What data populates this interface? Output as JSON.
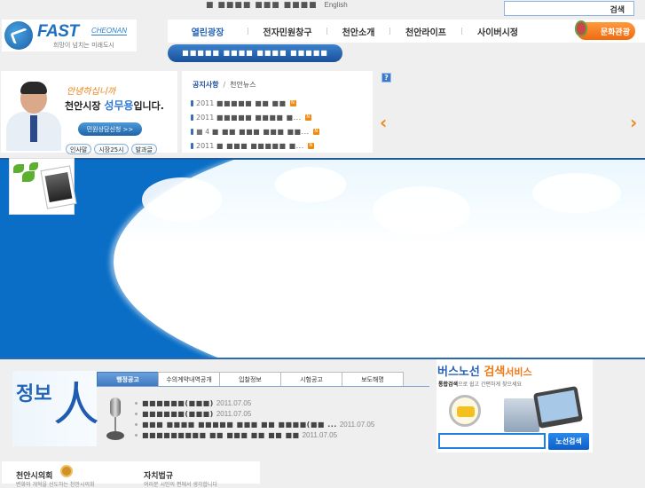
{
  "utility": {
    "links_text": "■ ■■■■ ■■■ ■■■■",
    "english": "English",
    "search_button": "검색",
    "search_placeholder": ""
  },
  "logo": {
    "brand": "FAST",
    "sub": "CHEONAN",
    "slogan": "희망이 넘치는 미래도시"
  },
  "nav": {
    "items": [
      "열린광장",
      "전자민원창구",
      "천안소개",
      "천안라이프",
      "사이버시정"
    ],
    "active_index": 0,
    "culture_button": "문화관광",
    "submenu_text": "■■■■■ ■■■■ ■■■■ ■■■■■"
  },
  "mayor": {
    "greeting": "안녕하십니까",
    "intro_prefix": "천안시장 ",
    "name": "성무용",
    "intro_suffix": "입니다.",
    "consult_button": "민원상담신청  >>",
    "pills": [
      "인사말",
      "시장25시",
      "발과글"
    ]
  },
  "notice": {
    "tab_active": "공지사항",
    "tab_separator": "/",
    "tab_other": "천안뉴스",
    "items": [
      {
        "year": "2011",
        "title": "■■■■■ ■■ ■■",
        "new": "N"
      },
      {
        "year": "2011",
        "title": "■■■■■ ■■■■ ■...",
        "new": "N"
      },
      {
        "year": "■ 4",
        "title": "■ ■■ ■■■ ■■■ ■■...",
        "new": "N"
      },
      {
        "year": "2011",
        "title": "■ ■■■ ■■■■■ ■...",
        "new": "N"
      }
    ]
  },
  "slider": {
    "help_label": "?",
    "prev_label": "‹",
    "next_label": "›"
  },
  "info": {
    "logo_text": "정보",
    "logo_char": "人",
    "tabs": [
      "행정공고",
      "수의계약내역공개",
      "입찰정보",
      "시험공고",
      "보도해명"
    ],
    "active_tab": 0,
    "items": [
      {
        "title": "■■■■■■(■■■)",
        "date": "2011.07.05"
      },
      {
        "title": "■■■■■■(■■■)",
        "date": "2011.07.05"
      },
      {
        "title": "■■■ ■■■■ ■■■■■ ■■■ ■■ ■■■■(■■ ...",
        "date": "2011.07.05"
      },
      {
        "title": "■■■■■■■■■ ■■ ■■■ ■■ ■■ ■■",
        "date": "2011.07.05"
      }
    ]
  },
  "bus": {
    "title_blue": "버스노선 ",
    "title_orange": "검색",
    "title_small": "서비스",
    "sub_bold": "통합검색",
    "sub_rest": "으로 쉽고 간편하게 찾으세요",
    "input_value": "",
    "search_button": "노선검색"
  },
  "bottom": {
    "council": "천안시의회",
    "council_sub": "변화와 개혁을 선도하는 천안시의회",
    "law": "자치법규",
    "law_sub": "여러분 시민의 편에서 생각합니다"
  },
  "colors": {
    "brand_blue": "#1e6fc0",
    "accent_orange": "#f08a20",
    "banner_blue": "#0a6ec6"
  }
}
